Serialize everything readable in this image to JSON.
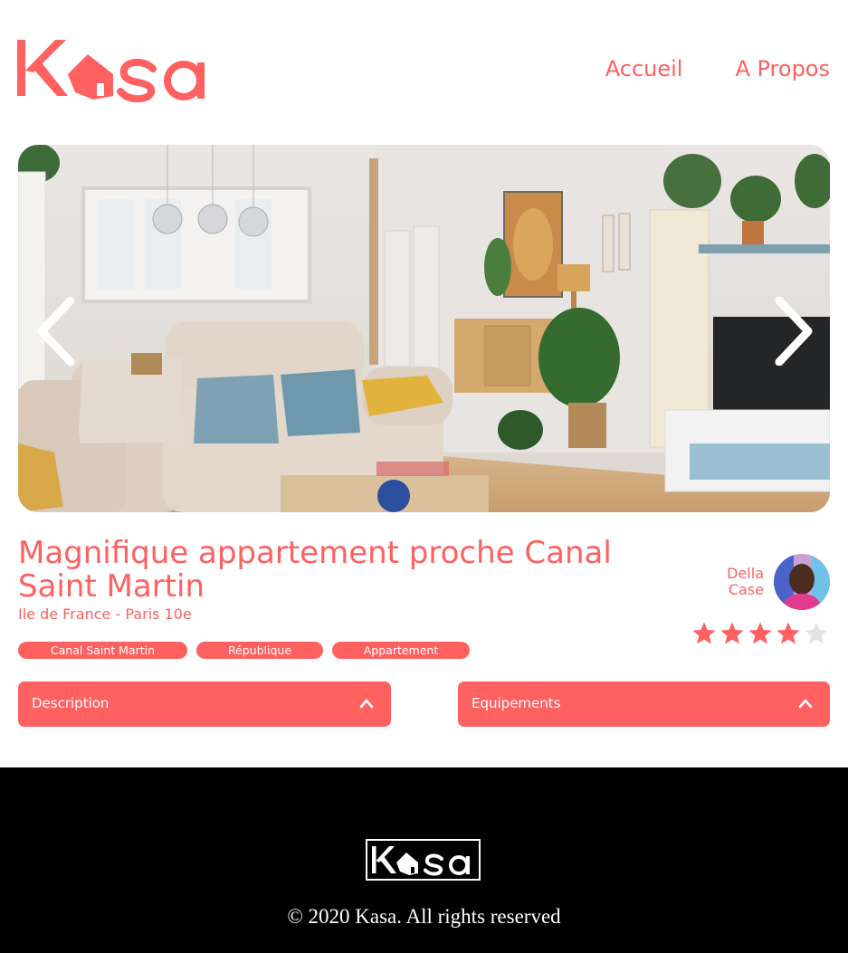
{
  "header": {
    "logo_text": "Kasa",
    "nav": [
      {
        "label": "Accueil"
      },
      {
        "label": "A Propos"
      }
    ]
  },
  "gallery": {
    "image_description": "living-room-photo",
    "prev_icon": "chevron-left-icon",
    "next_icon": "chevron-right-icon"
  },
  "listing": {
    "title": "Magnifique appartement proche Canal Saint Martin",
    "location": "Ile de France - Paris 10e",
    "tags": [
      "Canal Saint Martin",
      "République",
      "Appartement"
    ],
    "host": {
      "first_name": "Della",
      "last_name": "Case"
    },
    "rating": 4,
    "rating_max": 5
  },
  "collapses": {
    "description_label": "Description",
    "equipements_label": "Equipements"
  },
  "footer": {
    "logo_text": "Kasa",
    "copyright": "© 2020 Kasa. All rights reserved"
  },
  "colors": {
    "accent": "#ff6060",
    "star_empty": "#e3e3e3",
    "footer_bg": "#000000"
  }
}
